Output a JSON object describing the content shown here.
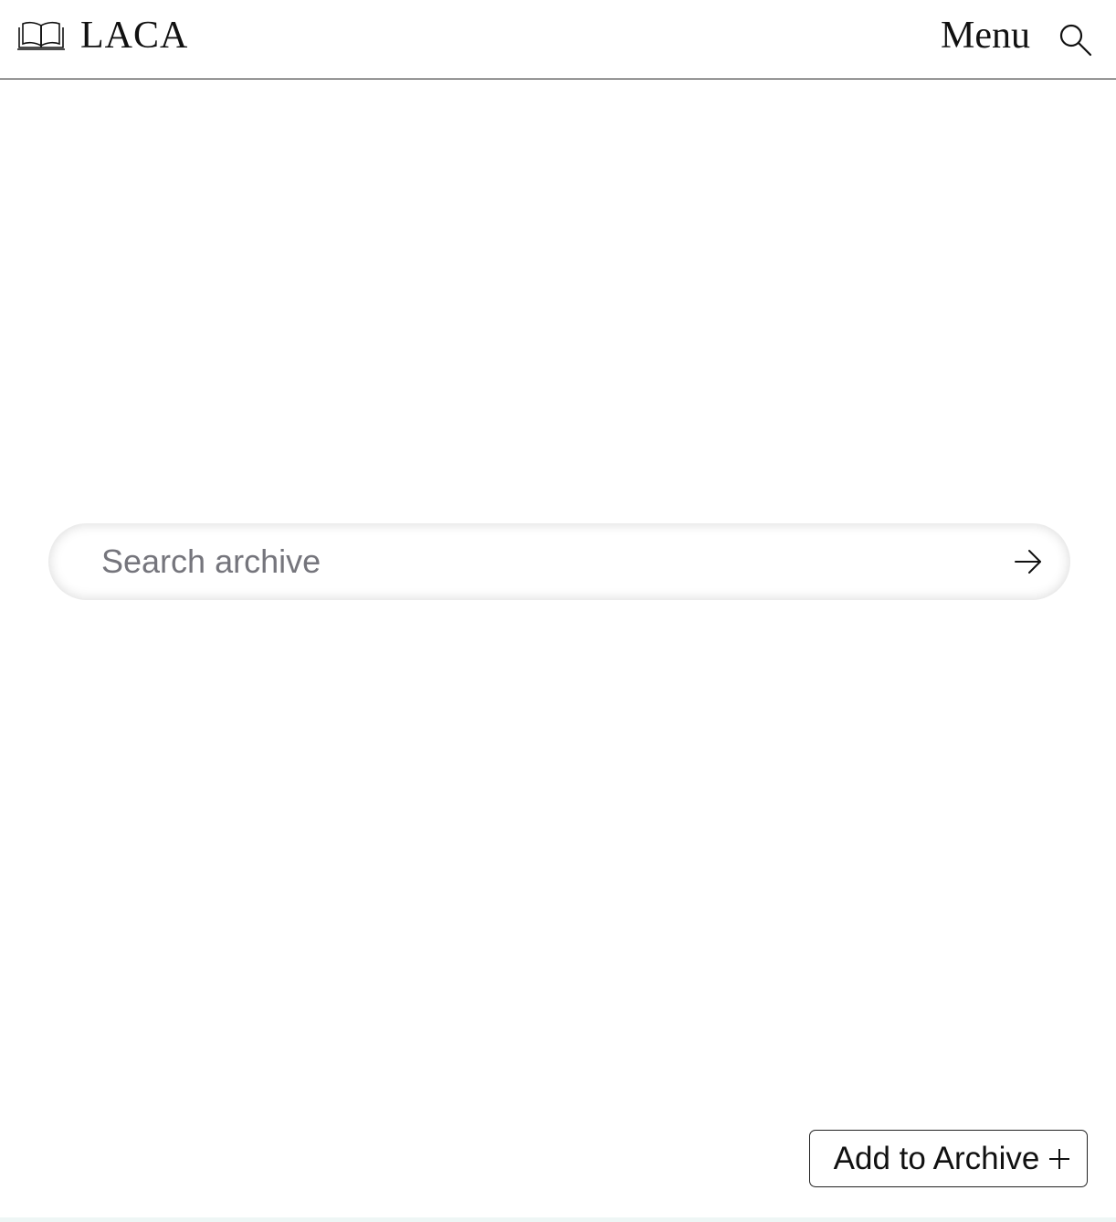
{
  "header": {
    "brand_icon": "open-book-icon",
    "brand_name": "LACA",
    "menu_label": "Menu",
    "search_icon": "magnifier-icon"
  },
  "search": {
    "placeholder": "Search archive",
    "value": "",
    "submit_icon": "arrow-right-icon"
  },
  "actions": {
    "add_label": "Add to Archive",
    "add_icon": "plus-icon"
  },
  "colors": {
    "text": "#111111",
    "placeholder": "#75757c",
    "border": "#222222",
    "background": "#ffffff",
    "footer_strip": "#eef6f5"
  }
}
